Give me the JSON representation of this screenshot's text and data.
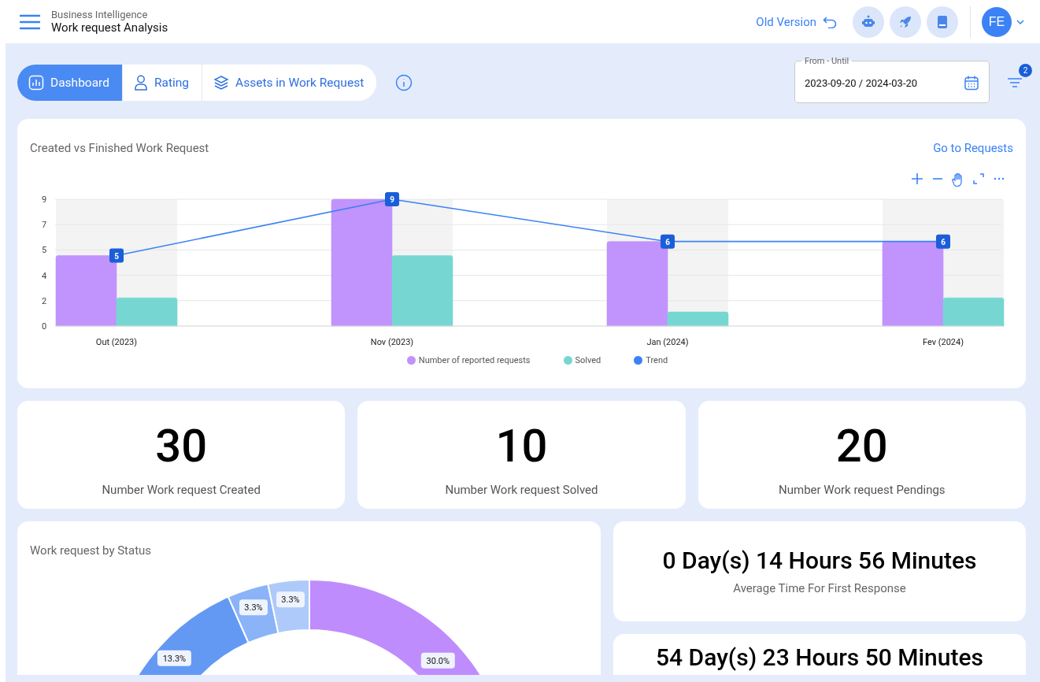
{
  "header": {
    "subtitle": "Business Intelligence",
    "title": "Work request Analysis",
    "old_version_link": "Old Version",
    "avatar_initials": "FE"
  },
  "tabs": [
    {
      "label": "Dashboard",
      "selected": true
    },
    {
      "label": "Rating",
      "selected": false
    },
    {
      "label": "Assets in Work Request",
      "selected": false
    }
  ],
  "date_filter": {
    "label": "From - Until",
    "value": "2023-09-20 / 2024-03-20"
  },
  "filter_badge": "2",
  "trend_chart": {
    "title": "Created vs Finished Work Request",
    "link": "Go to Requests",
    "chart_data": {
      "type": "bar",
      "categories": [
        "Out (2023)",
        "Nov (2023)",
        "Jan (2024)",
        "Fev (2024)"
      ],
      "series": [
        {
          "name": "Number of reported requests",
          "type": "bar",
          "color": "#c193fc",
          "values": [
            5,
            9,
            6,
            6
          ]
        },
        {
          "name": "Solved",
          "type": "bar",
          "color": "#76d7d2",
          "values": [
            2,
            5,
            1,
            2
          ]
        },
        {
          "name": "Trend",
          "type": "line",
          "color": "#3b82f6",
          "values": [
            5,
            9,
            6,
            6
          ],
          "marker": "square",
          "value_labels": [
            "5",
            "9",
            "6",
            "6"
          ]
        }
      ],
      "bands": [
        {
          "axis": "x",
          "from": "Out (2023)",
          "to": "Out (2023)",
          "color": "#f3f3f3"
        },
        {
          "axis": "x",
          "from": "Nov (2023)",
          "to": "Nov (2023)",
          "color": "#f3f3f3"
        },
        {
          "axis": "x",
          "from": "Jan (2024)",
          "to": "Jan (2024)",
          "color": "#f3f3f3"
        },
        {
          "axis": "x",
          "from": "Fev (2024)",
          "to": "Fev (2024)",
          "color": "#f3f3f3"
        }
      ],
      "stacked": false,
      "grid": true,
      "ylim": [
        0,
        9
      ],
      "yticks": [
        {
          "value": 0,
          "label": "0"
        },
        {
          "value": 1.8,
          "label": "2"
        },
        {
          "value": 3.6,
          "label": "4"
        },
        {
          "value": 5.4,
          "label": "5"
        },
        {
          "value": 7.2,
          "label": "7"
        },
        {
          "value": 9,
          "label": "9"
        }
      ]
    }
  },
  "kpis": [
    {
      "value": "30",
      "label": "Number Work request Created"
    },
    {
      "value": "10",
      "label": "Number Work request Solved"
    },
    {
      "value": "20",
      "label": "Number Work request Pendings"
    }
  ],
  "status_chart": {
    "title": "Work request by Status",
    "chart_data": {
      "type": "donut",
      "values": [
        30.0,
        13.3,
        3.3,
        3.3
      ],
      "value_labels": [
        "30.0%",
        "13.3%",
        "3.3%",
        "3.3%"
      ]
    }
  },
  "time_stats": [
    {
      "value": "0 Day(s) 14 Hours 56 Minutes",
      "label": "Average Time For First Response"
    },
    {
      "value": "54 Day(s) 23 Hours 50 Minutes"
    }
  ]
}
